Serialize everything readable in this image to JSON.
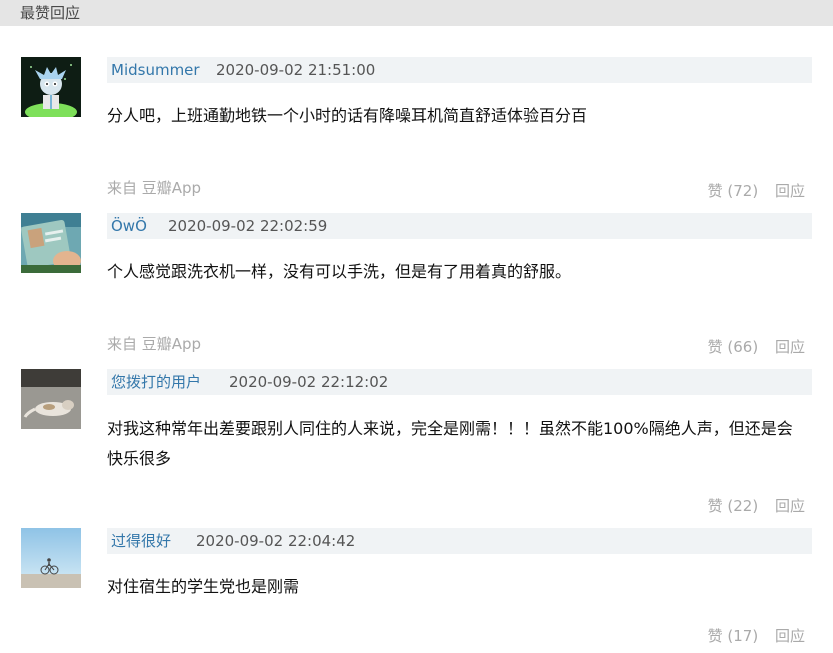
{
  "section": {
    "title": "最赞回应"
  },
  "comments": [
    {
      "author": "Midsummer",
      "time": "2020-09-02 21:51:00",
      "content": "分人吧，上班通勤地铁一个小时的话有降噪耳机简直舒适体验百分百",
      "source": "来自 豆瓣App",
      "vote_label": "赞 (72)",
      "reply_label": "回应"
    },
    {
      "author": "ÖwÖ",
      "time": "2020-09-02 22:02:59",
      "content": "个人感觉跟洗衣机一样，没有可以手洗，但是有了用着真的舒服。",
      "source": "来自 豆瓣App",
      "vote_label": "赞 (66)",
      "reply_label": "回应"
    },
    {
      "author": "您拨打的用户",
      "time": "2020-09-02 22:12:02",
      "content": "对我这种常年出差要跟别人同住的人来说，完全是刚需！！！虽然不能100%隔绝人声，但还是会快乐很多",
      "vote_label": "赞 (22)",
      "reply_label": "回应"
    },
    {
      "author": "过得很好",
      "time": "2020-09-02 22:04:42",
      "content": "对住宿生的学生党也是刚需",
      "vote_label": "赞 (17)",
      "reply_label": "回应"
    }
  ],
  "colors": {
    "link": "#3377aa",
    "meta_bg": "#f0f3f5",
    "muted": "#aaaaaa",
    "header_bg": "#e5e5e5"
  }
}
